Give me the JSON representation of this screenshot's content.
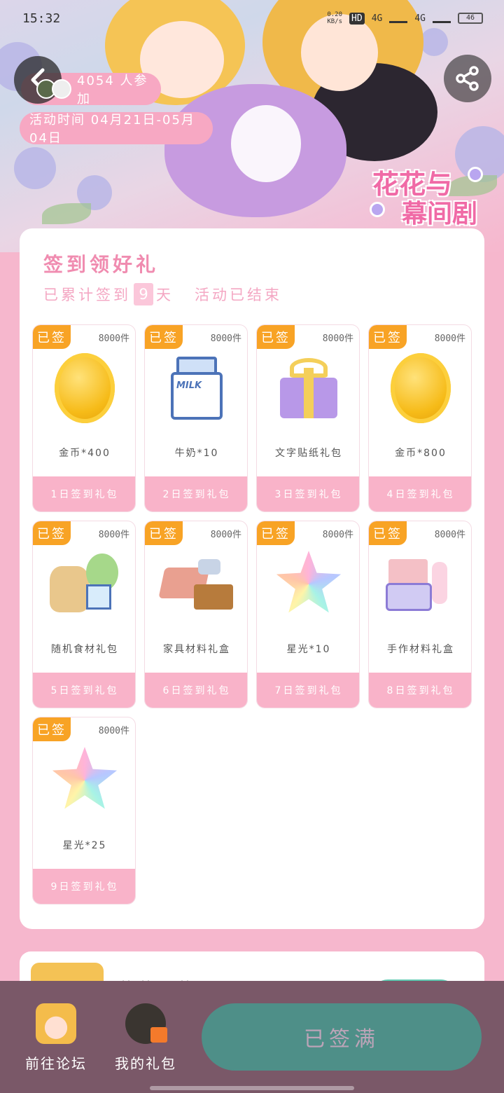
{
  "status_bar": {
    "time": "15:32",
    "net_speed": "0.20\nKB/s",
    "hd": "HD",
    "net1": "4G",
    "net2": "4G",
    "battery": "46"
  },
  "hero": {
    "participants": "4054 人参加",
    "event_time": "活动时间 04月21日-05月04日",
    "logo_line1": "花花与",
    "logo_line2": "幕间剧"
  },
  "card": {
    "title": "签到领好礼",
    "sub_prefix": "已累计签到",
    "days": "9",
    "sub_suffix": "天",
    "status": "活动已结束"
  },
  "gifts": [
    {
      "badge": "已签",
      "stock": "8000件",
      "name": "金币*400",
      "day": "1日签到礼包",
      "icon": "coin-icon"
    },
    {
      "badge": "已签",
      "stock": "8000件",
      "name": "牛奶*10",
      "day": "2日签到礼包",
      "icon": "milk-icon"
    },
    {
      "badge": "已签",
      "stock": "8000件",
      "name": "文字贴纸礼包",
      "day": "3日签到礼包",
      "icon": "gift-box-icon"
    },
    {
      "badge": "已签",
      "stock": "8000件",
      "name": "金币*800",
      "day": "4日签到礼包",
      "icon": "coin-icon"
    },
    {
      "badge": "已签",
      "stock": "8000件",
      "name": "随机食材礼包",
      "day": "5日签到礼包",
      "icon": "food-icon"
    },
    {
      "badge": "已签",
      "stock": "8000件",
      "name": "家具材料礼盒",
      "day": "6日签到礼包",
      "icon": "furniture-material-icon"
    },
    {
      "badge": "已签",
      "stock": "8000件",
      "name": "星光*10",
      "day": "7日签到礼包",
      "icon": "starlight-icon"
    },
    {
      "badge": "已签",
      "stock": "8000件",
      "name": "手作材料礼盒",
      "day": "8日签到礼包",
      "icon": "craft-material-icon"
    },
    {
      "badge": "已签",
      "stock": "8000件",
      "name": "星光*25",
      "day": "9日签到礼包",
      "icon": "starlight-icon"
    }
  ],
  "card2": {
    "title": "花花与幕间剧"
  },
  "bottom_bar": {
    "forum_label": "前往论坛",
    "gifts_label": "我的礼包",
    "signed_label": "已签满"
  },
  "colors": {
    "accent_pink": "#f9b3c9",
    "badge_orange": "#f8a325",
    "bottom_bar": "#7a5868",
    "signed_button": "#4e8f88"
  }
}
